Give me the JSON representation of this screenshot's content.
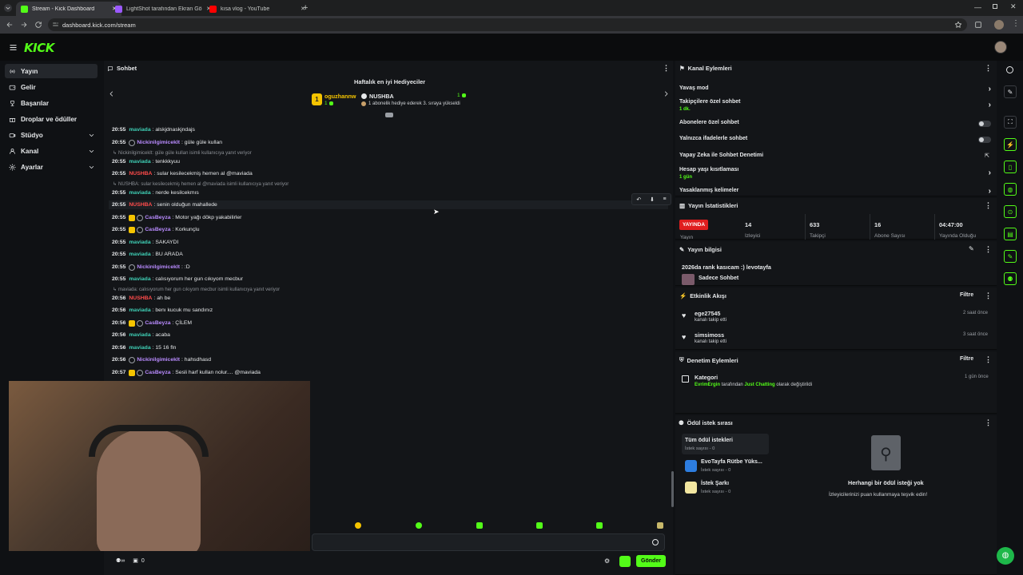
{
  "browser": {
    "tabs": [
      {
        "title": "Stream - Kick Dashboard",
        "color": "#53fc18"
      },
      {
        "title": "LightShot tarafından Ekran Gö...",
        "color": "#9b59ff"
      },
      {
        "title": "kısa vlog - YouTube",
        "color": "#ff0000"
      }
    ],
    "url": "dashboard.kick.com/stream"
  },
  "brand": {
    "logo": "KICK",
    "accent": "#53fc18"
  },
  "sidebar": {
    "items": [
      {
        "label": "Yayın",
        "icon": "broadcast-icon"
      },
      {
        "label": "Gelir",
        "icon": "wallet-icon"
      },
      {
        "label": "Başarılar",
        "icon": "trophy-icon"
      },
      {
        "label": "Droplar ve ödüller",
        "icon": "gift-icon"
      },
      {
        "label": "Stüdyo",
        "icon": "camera-icon"
      },
      {
        "label": "Kanal",
        "icon": "user-icon"
      },
      {
        "label": "Ayarlar",
        "icon": "gear-icon"
      }
    ]
  },
  "chat": {
    "title": "Sohbet",
    "gifters": {
      "title": "Haftalık en iyi Hediyeciler",
      "first": {
        "name": "oguzhannw",
        "count": "1",
        "right_count": "1"
      },
      "second": {
        "name": "NUSHBA",
        "note": "1 abonelik hediye ederek 3. sıraya yükseldi"
      }
    },
    "messages": [
      {
        "time": "20:55",
        "user": "maviada",
        "text": ": alskjdnaskjndajs"
      },
      {
        "time": "20:55",
        "user": "Nickinilgimiceklt",
        "text": ": güle güle kullan"
      },
      {
        "reply": "Nickinilgimiceklt: güle güle kullan isimli kullanıcıya yanıt veriyor"
      },
      {
        "time": "20:55",
        "user": "maviada",
        "text": ": tenkkkyuu"
      },
      {
        "time": "20:55",
        "user": "NUSHBA",
        "text": ": sular kesilecekmiş hemen al @maviada"
      },
      {
        "reply": "NUSHBA: sular kesilecekmiş hemen al @maviada isimli kullanıcıya yanıt veriyor"
      },
      {
        "time": "20:55",
        "user": "maviada",
        "text": ": nerde kesilcekmıs"
      },
      {
        "time": "20:55",
        "user": "NUSHBA",
        "text": ": senin olduğun mahallede"
      },
      {
        "time": "20:55",
        "user": "CasBeyza",
        "text": ": Motor yağı dökp yakabilirler"
      },
      {
        "time": "20:55",
        "user": "CasBeyza",
        "text": ": Korkunçlu"
      },
      {
        "time": "20:55",
        "user": "maviada",
        "text": ": SAKAYDI"
      },
      {
        "time": "20:55",
        "user": "maviada",
        "text": ": BU ARADA"
      },
      {
        "time": "20:55",
        "user": "Nickinilgimiceklt",
        "text": ": :D"
      },
      {
        "time": "20:55",
        "user": "maviada",
        "text": ": calısıyorum her gun cıkıyom mecbur"
      },
      {
        "reply": "maviada: calısıyorum her gun cıkıyom mecbur isimli kullanıcıya yanıt veriyor"
      },
      {
        "time": "20:56",
        "user": "NUSHBA",
        "text": ": ah be"
      },
      {
        "time": "20:56",
        "user": "maviada",
        "text": ": benı kucuk mu sandınız"
      },
      {
        "time": "20:56",
        "user": "CasBeyza",
        "text": ": ÇİLEM"
      },
      {
        "time": "20:56",
        "user": "maviada",
        "text": ": acaba"
      },
      {
        "time": "20:56",
        "user": "maviada",
        "text": ": 15 16 fln"
      },
      {
        "time": "20:56",
        "user": "Nickinilgimiceklt",
        "text": ": hahsdhasd"
      },
      {
        "time": "20:57",
        "user": "CasBeyza",
        "text": ": Sesli harf kullan nolur.... @maviada"
      }
    ],
    "user_colors": {
      "maviada": "#3fd0b6",
      "Nickinilgimiceklt": "#b98bff",
      "NUSHBA": "#ff4b4b",
      "CasBeyza": "#b98bff"
    },
    "send_label": "Gönder",
    "footer_count": "0"
  },
  "kanal_eylemleri": {
    "title": "Kanal Eylemleri",
    "rows": [
      {
        "label": "Yavaş mod",
        "sub": ""
      },
      {
        "label": "Takipçilere özel sohbet",
        "sub": "1 dk."
      },
      {
        "label": "Abonelere özel sohbet",
        "sub": ""
      },
      {
        "label": "Yalnızca ifadelerle sohbet",
        "sub": ""
      },
      {
        "label": "Yapay Zeka ile Sohbet Denetimi",
        "sub": ""
      },
      {
        "label": "Hesap yaşı kısıtlaması",
        "sub": "1 gün"
      },
      {
        "label": "Yasaklanmış kelimeler",
        "sub": ""
      }
    ]
  },
  "istatistik": {
    "title": "Yayın İstatistikleri",
    "live": "YAYINDA",
    "live_sub": "Yayın",
    "stats": [
      {
        "value": "14",
        "label": "İzleyici"
      },
      {
        "value": "633",
        "label": "Takipçi"
      },
      {
        "value": "16",
        "label": "Abone Sayısı"
      },
      {
        "value": "04:47:00",
        "label": "Yayında Olduğu"
      }
    ]
  },
  "yayin_bilgisi": {
    "title": "Yayın bilgisi",
    "stream_title": "2026da rank kasıcam :) levotayfa",
    "mode": "Sadece Sohbet"
  },
  "etkinlik": {
    "title": "Etkinlik Akışı",
    "filter": "Filtre",
    "items": [
      {
        "user": "ege27545",
        "action": "kanalı takip etti",
        "time": "2 saat önce"
      },
      {
        "user": "simsimoss",
        "action": "kanalı takip etti",
        "time": "3 saat önce"
      }
    ]
  },
  "denetim": {
    "title": "Denetim Eylemleri",
    "filter": "Filtre",
    "item": {
      "title": "Kategori",
      "by": "EvrimErgin",
      "mid": "tarafından",
      "category": "Just Chatting",
      "tail": "olarak değiştirildi",
      "time": "1 gün önce"
    }
  },
  "odul": {
    "title": "Ödül istek sırası",
    "list": [
      {
        "name": "Tüm ödül istekleri",
        "sub": "İstek sayısı - 0"
      },
      {
        "name": "EvoTayfa Rütbe Yüks...",
        "sub": "İstek sayısı - 0"
      },
      {
        "name": "İstek Şarkı",
        "sub": "İstek sayısı - 0"
      }
    ],
    "empty_title": "Herhangi bir ödül isteği yok",
    "empty_sub": "İzleyicilerinizi puan kullanmaya teşvik edin!"
  }
}
